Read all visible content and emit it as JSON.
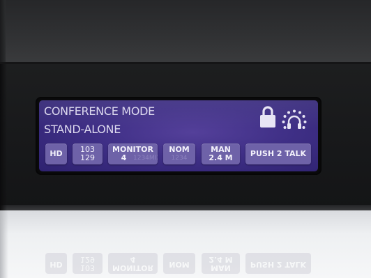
{
  "display": {
    "line1": "CONFERENCE MODE",
    "line2": "STAND-ALONE",
    "status_icons": [
      "lock-icon",
      "headset-icon"
    ]
  },
  "buttons": {
    "hd": "HD",
    "channels_top": "103",
    "channels_bottom": "129",
    "monitor_label": "MONITOR",
    "monitor_value": "4",
    "monitor_dim": "1234MIX",
    "nom_label": "NOM",
    "nom_dim": "1234",
    "man_label": "MAN",
    "man_value": "2.4 M",
    "push_to_talk": "PUSH 2 TALK"
  },
  "colors": {
    "lcd": "#3f2f86",
    "chip": "#6e62a8",
    "text": "#dcd8ee"
  }
}
